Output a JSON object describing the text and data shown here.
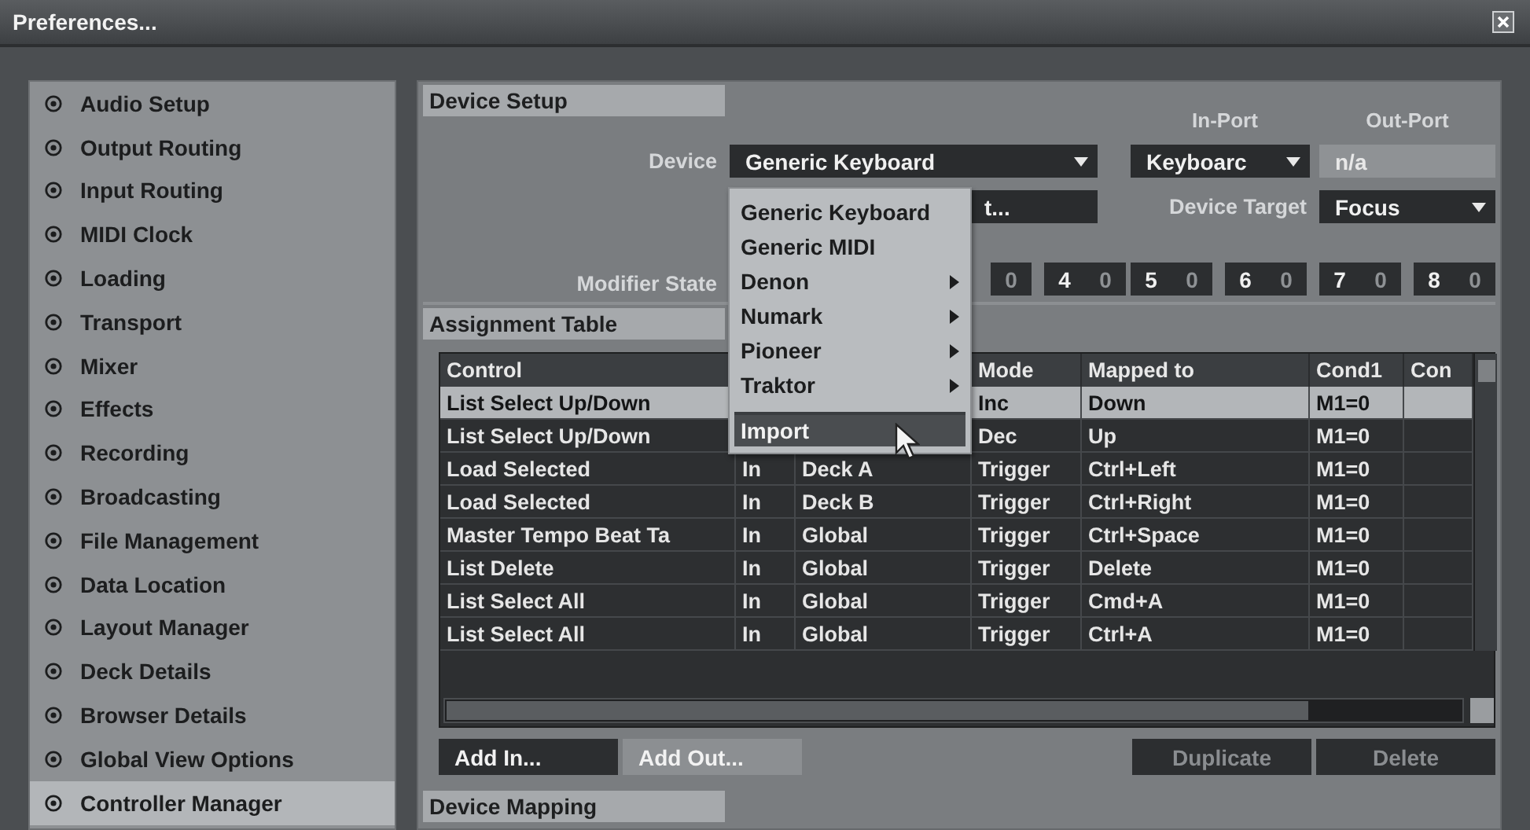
{
  "window": {
    "title": "Preferences..."
  },
  "sidebar": {
    "items": [
      {
        "label": "Audio Setup",
        "selected": false
      },
      {
        "label": "Output Routing",
        "selected": false
      },
      {
        "label": "Input Routing",
        "selected": false
      },
      {
        "label": "MIDI Clock",
        "selected": false
      },
      {
        "label": "Loading",
        "selected": false
      },
      {
        "label": "Transport",
        "selected": false
      },
      {
        "label": "Mixer",
        "selected": false
      },
      {
        "label": "Effects",
        "selected": false
      },
      {
        "label": "Recording",
        "selected": false
      },
      {
        "label": "Broadcasting",
        "selected": false
      },
      {
        "label": "File Management",
        "selected": false
      },
      {
        "label": "Data Location",
        "selected": false
      },
      {
        "label": "Layout Manager",
        "selected": false
      },
      {
        "label": "Deck Details",
        "selected": false
      },
      {
        "label": "Browser Details",
        "selected": false
      },
      {
        "label": "Global View Options",
        "selected": false
      },
      {
        "label": "Controller Manager",
        "selected": true
      }
    ]
  },
  "device_setup": {
    "title": "Device Setup",
    "port_labels": [
      "In-Port",
      "Out-Port"
    ],
    "device_label": "Device",
    "device": "Generic Keyboard",
    "in_port": "Keyboarc",
    "out_port": {
      "value": "n/a",
      "disabled": true
    },
    "second_field": "t...",
    "target_label": "Device Target",
    "target": "Focus",
    "modifier_label": "Modifier State",
    "modifiers": [
      {
        "value": "0"
      },
      {
        "key": "4",
        "value": "0"
      },
      {
        "key": "5",
        "value": "0"
      },
      {
        "key": "6",
        "value": "0"
      },
      {
        "key": "7",
        "value": "0"
      },
      {
        "key": "8",
        "value": "0"
      }
    ]
  },
  "device_menu": {
    "items": [
      {
        "label": "Generic Keyboard",
        "submenu": false,
        "selected": false,
        "separator_before": false
      },
      {
        "label": "Generic MIDI",
        "submenu": false,
        "selected": false,
        "separator_before": false
      },
      {
        "label": "Denon",
        "submenu": true,
        "selected": false,
        "separator_before": false
      },
      {
        "label": "Numark",
        "submenu": true,
        "selected": false,
        "separator_before": false
      },
      {
        "label": "Pioneer",
        "submenu": true,
        "selected": false,
        "separator_before": false
      },
      {
        "label": "Traktor",
        "submenu": true,
        "selected": false,
        "separator_before": false
      },
      {
        "label": "Import",
        "submenu": false,
        "selected": true,
        "separator_before": true
      }
    ]
  },
  "assignment_table": {
    "title": "Assignment Table",
    "columns": [
      "Control",
      null,
      null,
      "Mode",
      "Mapped to",
      "Cond1",
      "Con"
    ],
    "rows": [
      {
        "selected": true,
        "cells": [
          "List Select Up/Down",
          null,
          null,
          "Inc",
          "Down",
          "M1=0"
        ]
      },
      {
        "selected": false,
        "cells": [
          "List Select Up/Down",
          null,
          null,
          "Dec",
          "Up",
          "M1=0"
        ]
      },
      {
        "selected": false,
        "cells": [
          "Load Selected",
          "In",
          "Deck A",
          "Trigger",
          "Ctrl+Left",
          "M1=0"
        ]
      },
      {
        "selected": false,
        "cells": [
          "Load Selected",
          "In",
          "Deck B",
          "Trigger",
          "Ctrl+Right",
          "M1=0"
        ]
      },
      {
        "selected": false,
        "cells": [
          "Master Tempo Beat Ta",
          "In",
          "Global",
          "Trigger",
          "Ctrl+Space",
          "M1=0"
        ]
      },
      {
        "selected": false,
        "cells": [
          "List Delete",
          "In",
          "Global",
          "Trigger",
          "Delete",
          "M1=0"
        ]
      },
      {
        "selected": false,
        "cells": [
          "List Select All",
          "In",
          "Global",
          "Trigger",
          "Cmd+A",
          "M1=0"
        ]
      },
      {
        "selected": false,
        "cells": [
          "List Select All",
          "In",
          "Global",
          "Trigger",
          "Ctrl+A",
          "M1=0"
        ]
      }
    ]
  },
  "buttons": [
    {
      "label": "Add In...",
      "highlighted": false,
      "disabled": false
    },
    {
      "label": "Add Out...",
      "highlighted": true,
      "disabled": false
    },
    {
      "label": "Duplicate",
      "highlighted": false,
      "disabled": true
    },
    {
      "label": "Delete",
      "highlighted": false,
      "disabled": true
    }
  ],
  "device_mapping": {
    "title": "Device Mapping"
  }
}
